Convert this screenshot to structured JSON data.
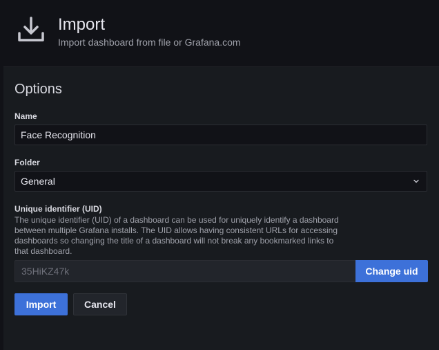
{
  "header": {
    "title": "Import",
    "subtitle": "Import dashboard from file or Grafana.com",
    "icon": "import-download-icon"
  },
  "options": {
    "title": "Options",
    "name_label": "Name",
    "name_value": "Face Recognition",
    "folder_label": "Folder",
    "folder_value": "General",
    "uid_label": "Unique identifier (UID)",
    "uid_description": "The unique identifier (UID) of a dashboard can be used for uniquely identify a dashboard between multiple Grafana installs. The UID allows having consistent URLs for accessing dashboards so changing the title of a dashboard will not break any bookmarked links to that dashboard.",
    "uid_value": "35HiKZ47k",
    "change_uid_label": "Change uid"
  },
  "actions": {
    "import_label": "Import",
    "cancel_label": "Cancel"
  },
  "colors": {
    "primary": "#3d71d9",
    "background": "#111217",
    "panel": "#181b1f"
  }
}
